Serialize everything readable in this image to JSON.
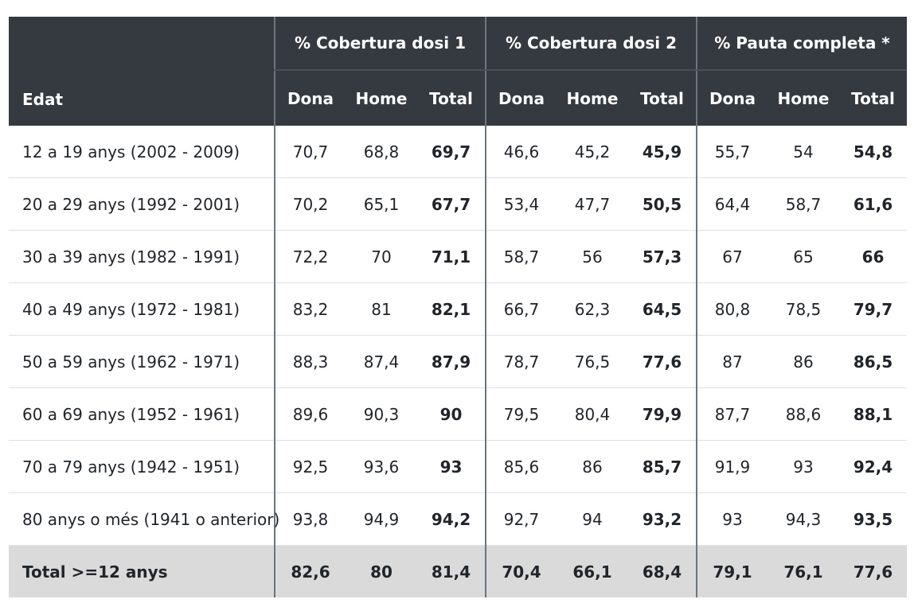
{
  "header": {
    "edat": "Edat",
    "groups": [
      "% Cobertura dosi 1",
      "% Cobertura dosi 2",
      "% Pauta completa *"
    ],
    "subs": [
      "Dona",
      "Home",
      "Total"
    ]
  },
  "rows": [
    {
      "edat": "12 a 19 anys (2002 - 2009)",
      "v": [
        "70,7",
        "68,8",
        "69,7",
        "46,6",
        "45,2",
        "45,9",
        "55,7",
        "54",
        "54,8"
      ]
    },
    {
      "edat": "20 a 29 anys (1992 - 2001)",
      "v": [
        "70,2",
        "65,1",
        "67,7",
        "53,4",
        "47,7",
        "50,5",
        "64,4",
        "58,7",
        "61,6"
      ]
    },
    {
      "edat": "30 a 39 anys (1982 - 1991)",
      "v": [
        "72,2",
        "70",
        "71,1",
        "58,7",
        "56",
        "57,3",
        "67",
        "65",
        "66"
      ]
    },
    {
      "edat": "40 a 49 anys (1972 - 1981)",
      "v": [
        "83,2",
        "81",
        "82,1",
        "66,7",
        "62,3",
        "64,5",
        "80,8",
        "78,5",
        "79,7"
      ]
    },
    {
      "edat": "50 a 59 anys (1962 - 1971)",
      "v": [
        "88,3",
        "87,4",
        "87,9",
        "78,7",
        "76,5",
        "77,6",
        "87",
        "86",
        "86,5"
      ]
    },
    {
      "edat": "60 a 69 anys (1952 - 1961)",
      "v": [
        "89,6",
        "90,3",
        "90",
        "79,5",
        "80,4",
        "79,9",
        "87,7",
        "88,6",
        "88,1"
      ]
    },
    {
      "edat": "70 a 79 anys (1942 - 1951)",
      "v": [
        "92,5",
        "93,6",
        "93",
        "85,6",
        "86",
        "85,7",
        "91,9",
        "93",
        "92,4"
      ]
    },
    {
      "edat": "80 anys o més (1941 o anterior)",
      "v": [
        "93,8",
        "94,9",
        "94,2",
        "92,7",
        "94",
        "93,2",
        "93",
        "94,3",
        "93,5"
      ]
    }
  ],
  "footer": {
    "edat": "Total >=12 anys",
    "v": [
      "82,6",
      "80",
      "81,4",
      "70,4",
      "66,1",
      "68,4",
      "79,1",
      "76,1",
      "77,6"
    ]
  }
}
